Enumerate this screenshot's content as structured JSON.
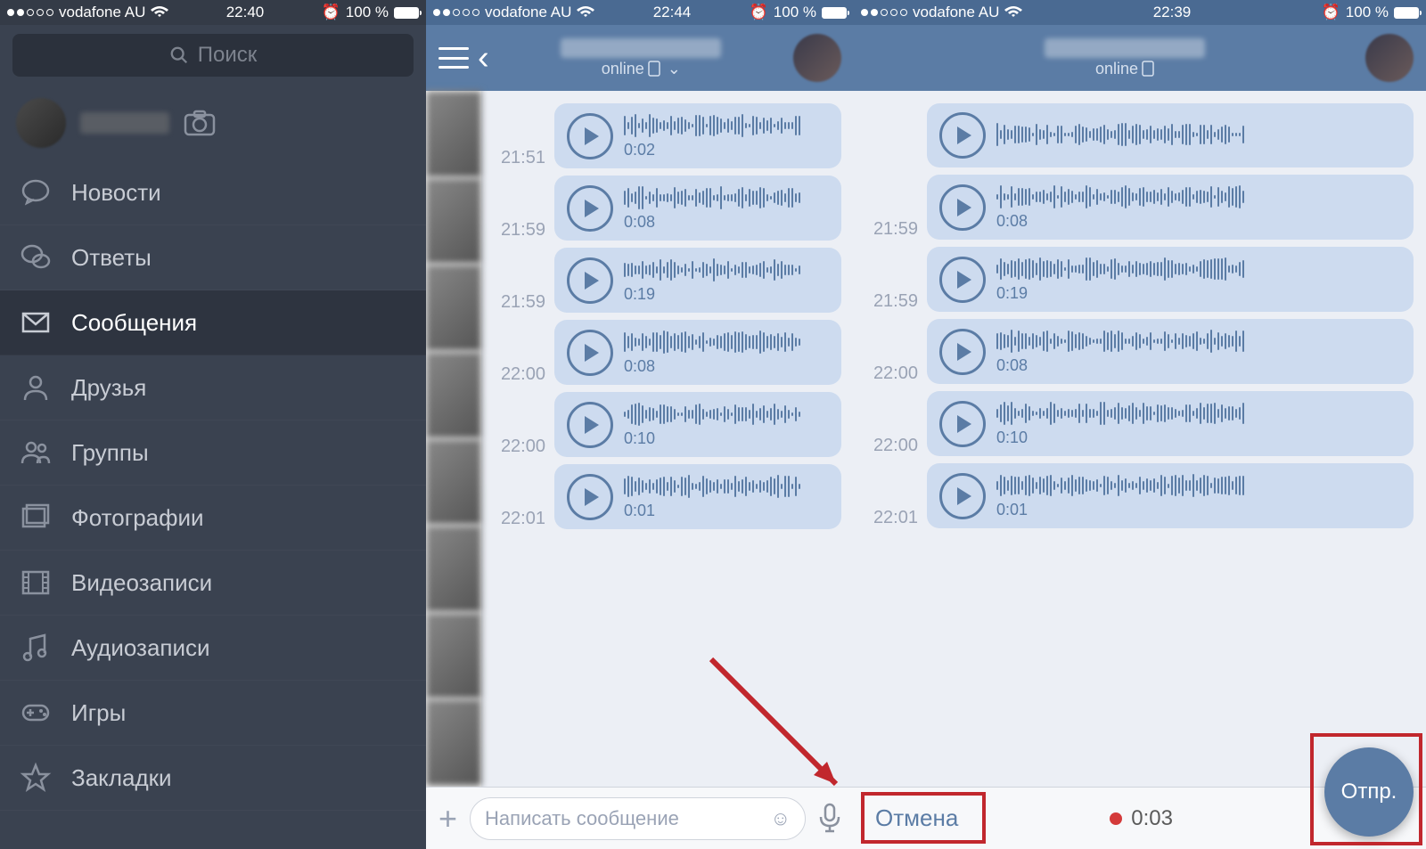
{
  "status_bars": [
    {
      "carrier": "vodafone AU",
      "time": "22:40",
      "battery": "100 %"
    },
    {
      "carrier": "vodafone AU",
      "time": "22:44",
      "battery": "100 %"
    },
    {
      "carrier": "vodafone AU",
      "time": "22:39",
      "battery": "100 %"
    }
  ],
  "sidebar": {
    "search_placeholder": "Поиск",
    "items": [
      {
        "icon": "speech",
        "label": "Новости"
      },
      {
        "icon": "replies",
        "label": "Ответы"
      },
      {
        "icon": "envelope",
        "label": "Сообщения",
        "active": true
      },
      {
        "icon": "person",
        "label": "Друзья"
      },
      {
        "icon": "people",
        "label": "Группы"
      },
      {
        "icon": "photos",
        "label": "Фотографии"
      },
      {
        "icon": "video",
        "label": "Видеозаписи"
      },
      {
        "icon": "music",
        "label": "Аудиозаписи"
      },
      {
        "icon": "gamepad",
        "label": "Игры"
      },
      {
        "icon": "star",
        "label": "Закладки"
      }
    ]
  },
  "chat": {
    "status": "online",
    "input_placeholder": "Написать сообщение",
    "messages_a": [
      {
        "time": "21:51",
        "duration": "0:02"
      },
      {
        "time": "21:59",
        "duration": "0:08"
      },
      {
        "time": "21:59",
        "duration": "0:19"
      },
      {
        "time": "22:00",
        "duration": "0:08"
      },
      {
        "time": "22:00",
        "duration": "0:10"
      },
      {
        "time": "22:01",
        "duration": "0:01"
      }
    ],
    "messages_b": [
      {
        "time": "",
        "duration": ""
      },
      {
        "time": "21:59",
        "duration": "0:08"
      },
      {
        "time": "21:59",
        "duration": "0:19"
      },
      {
        "time": "22:00",
        "duration": "0:08"
      },
      {
        "time": "22:00",
        "duration": "0:10"
      },
      {
        "time": "22:01",
        "duration": "0:01"
      }
    ]
  },
  "recording": {
    "cancel_label": "Отмена",
    "elapsed": "0:03",
    "send_label": "Отпр."
  }
}
